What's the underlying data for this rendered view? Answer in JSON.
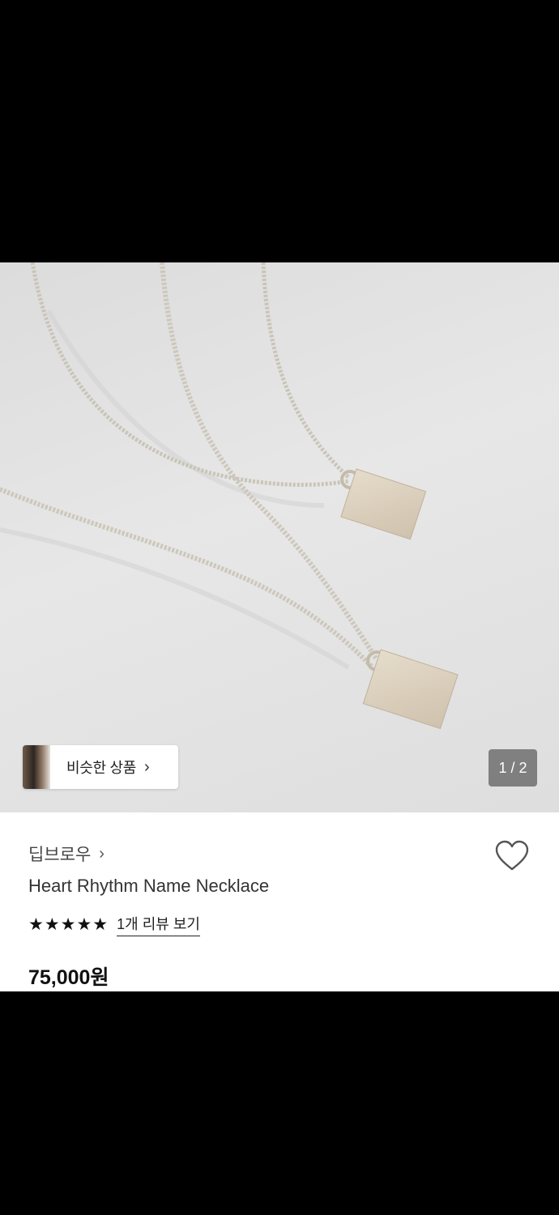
{
  "similar_products": {
    "label": "비슷한 상품",
    "arrow": "›"
  },
  "gallery": {
    "counter": "1 / 2"
  },
  "product": {
    "brand": "딥브로우",
    "brand_arrow": "›",
    "name": "Heart Rhythm Name Necklace",
    "rating_stars": "★★★★★",
    "review_link": "1개 리뷰 보기",
    "price": "75,000원"
  },
  "icons": {
    "heart": "heart-outline-icon",
    "star": "star-icon",
    "chevron": "chevron-right-icon"
  }
}
